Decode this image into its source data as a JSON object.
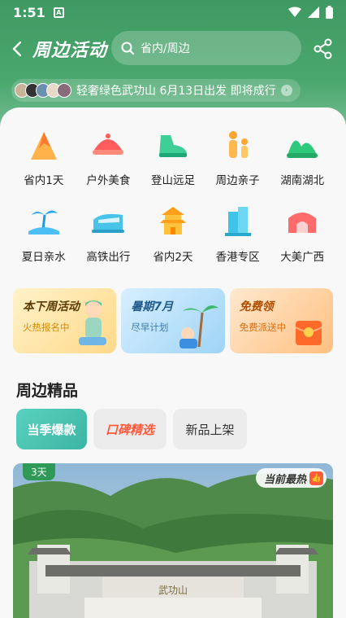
{
  "status": {
    "time": "1:51",
    "notif": "A"
  },
  "header": {
    "title": "周边活动",
    "search_text": "省内/周边"
  },
  "ticker": {
    "text": "轻奢绿色武功山 6月13日出发 即将成行"
  },
  "categories": [
    {
      "label": "省内1天",
      "icon": "mountain-icon"
    },
    {
      "label": "户外美食",
      "icon": "food-dome-icon"
    },
    {
      "label": "登山远足",
      "icon": "hiking-shoe-icon"
    },
    {
      "label": "周边亲子",
      "icon": "family-icon"
    },
    {
      "label": "湖南湖北",
      "icon": "hills-icon"
    },
    {
      "label": "夏日亲水",
      "icon": "island-icon"
    },
    {
      "label": "高铁出行",
      "icon": "train-icon"
    },
    {
      "label": "省内2天",
      "icon": "pagoda-icon"
    },
    {
      "label": "香港专区",
      "icon": "buildings-icon"
    },
    {
      "label": "大美广西",
      "icon": "landmark-icon"
    }
  ],
  "banners": [
    {
      "title": "本下周活动",
      "sub": "火热报名中"
    },
    {
      "title": "暑期7月",
      "sub": "尽早计划"
    },
    {
      "title": "免费领",
      "sub": "免费派送中"
    }
  ],
  "section": {
    "title": "周边精品"
  },
  "tabs": [
    {
      "label": "当季爆款"
    },
    {
      "label": "口碑精选"
    },
    {
      "label": "新品上架"
    }
  ],
  "card": {
    "days": "3天",
    "hot_label": "当前最热",
    "gate_text": "武功山"
  },
  "colors": {
    "primary_green": "#3e9a62",
    "accent_teal": "#3bb6a4",
    "hot_red": "#ff5b3b"
  }
}
